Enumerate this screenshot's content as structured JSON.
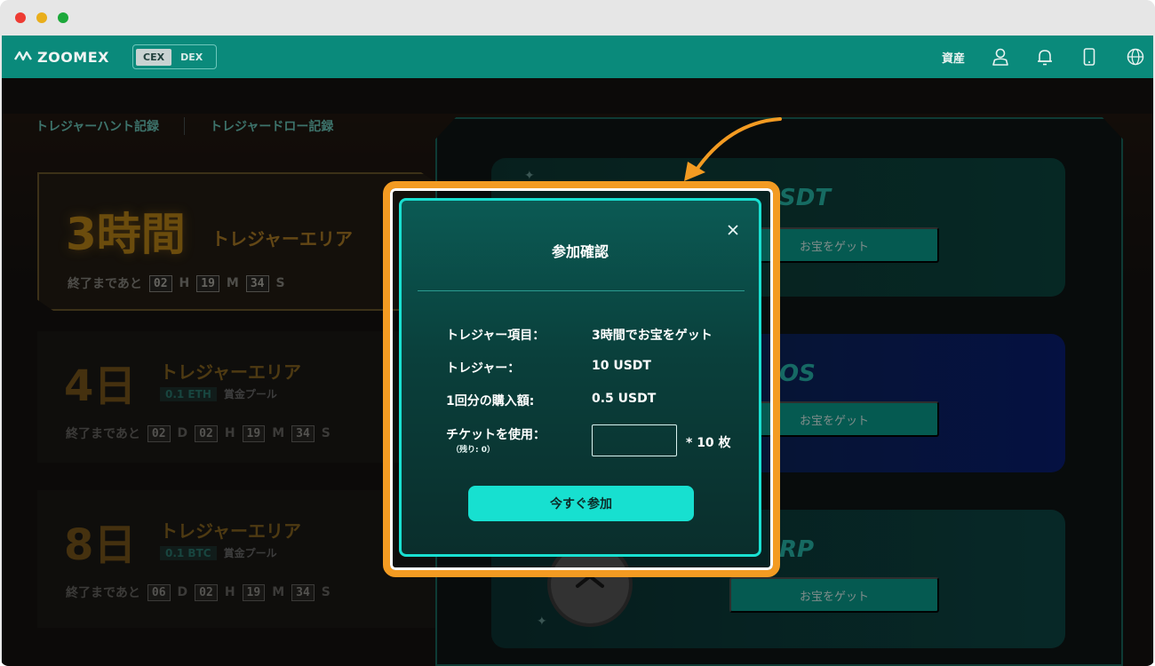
{
  "window": {
    "controls": [
      "close",
      "minimize",
      "maximize"
    ]
  },
  "navbar": {
    "brand": "ZOOMEX",
    "switch": {
      "cex": "CEX",
      "dex": "DEX"
    },
    "assets_label": "資産",
    "icons": [
      "user-icon",
      "bell-icon",
      "mobile-icon",
      "globe-icon"
    ]
  },
  "tabs": [
    "トレジャーハント記録",
    "トレジャードロー記録"
  ],
  "cards": [
    {
      "duration": "3時間",
      "area": "トレジャーエリア",
      "pool_amount": "",
      "pool_label": "",
      "timer_label": "終了まであと",
      "timer": [
        {
          "v": "02",
          "u": "H"
        },
        {
          "v": "19",
          "u": "M"
        },
        {
          "v": "34",
          "u": "S"
        }
      ]
    },
    {
      "duration": "4日",
      "area": "トレジャーエリア",
      "pool_amount": "0.1 ETH",
      "pool_label": "賞金プール",
      "timer_label": "終了まであと",
      "timer": [
        {
          "v": "02",
          "u": "D"
        },
        {
          "v": "02",
          "u": "H"
        },
        {
          "v": "19",
          "u": "M"
        },
        {
          "v": "34",
          "u": "S"
        }
      ]
    },
    {
      "duration": "8日",
      "area": "トレジャーエリア",
      "pool_amount": "0.1 BTC",
      "pool_label": "賞金プール",
      "timer_label": "終了まであと",
      "timer": [
        {
          "v": "06",
          "u": "D"
        },
        {
          "v": "02",
          "u": "H"
        },
        {
          "v": "19",
          "u": "M"
        },
        {
          "v": "34",
          "u": "S"
        }
      ]
    }
  ],
  "treasures": [
    {
      "title": "SDT",
      "button": "お宝をゲット"
    },
    {
      "title": "OS",
      "button": "お宝をゲット"
    },
    {
      "title": "RP",
      "button": "お宝をゲット"
    }
  ],
  "modal": {
    "title": "参加確認",
    "rows": [
      {
        "key": "トレジャー項目：",
        "value": "3時間でお宝をゲット"
      },
      {
        "key": "トレジャー：",
        "value": "10 USDT"
      },
      {
        "key": "1回分の購入額:",
        "value": "0.5 USDT"
      }
    ],
    "ticket": {
      "key": "チケットを使用：",
      "sub": "（残り: 0）",
      "value": "",
      "placeholder": "",
      "suffix": "* 10 枚"
    },
    "join_button": "今すぐ参加"
  },
  "colors": {
    "accent": "#19e0d1",
    "highlight": "#f39b22",
    "nav": "#0a8a7b"
  }
}
